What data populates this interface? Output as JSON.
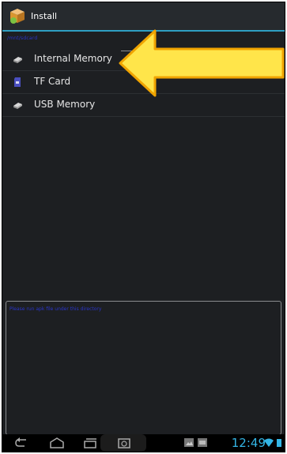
{
  "window": {
    "title": "Install"
  },
  "path_text": "/mnt/sdcard",
  "storage_list": [
    {
      "label": "Internal Memory",
      "icon": "internal-storage-icon",
      "selected": true
    },
    {
      "label": "TF Card",
      "icon": "sd-card-icon",
      "selected": false
    },
    {
      "label": "USB Memory",
      "icon": "usb-storage-icon",
      "selected": false
    }
  ],
  "log_panel": {
    "text": "Please run apk file under this directory"
  },
  "navbar": {
    "clock": "12:49",
    "buttons": [
      "back-icon",
      "home-icon",
      "recent-apps-icon",
      "screenshot-icon"
    ]
  },
  "colors": {
    "accent": "#2e9fc4",
    "clock": "#33b5e5",
    "arrow_fill": "#ffe54a",
    "arrow_stroke": "#f0a400"
  }
}
